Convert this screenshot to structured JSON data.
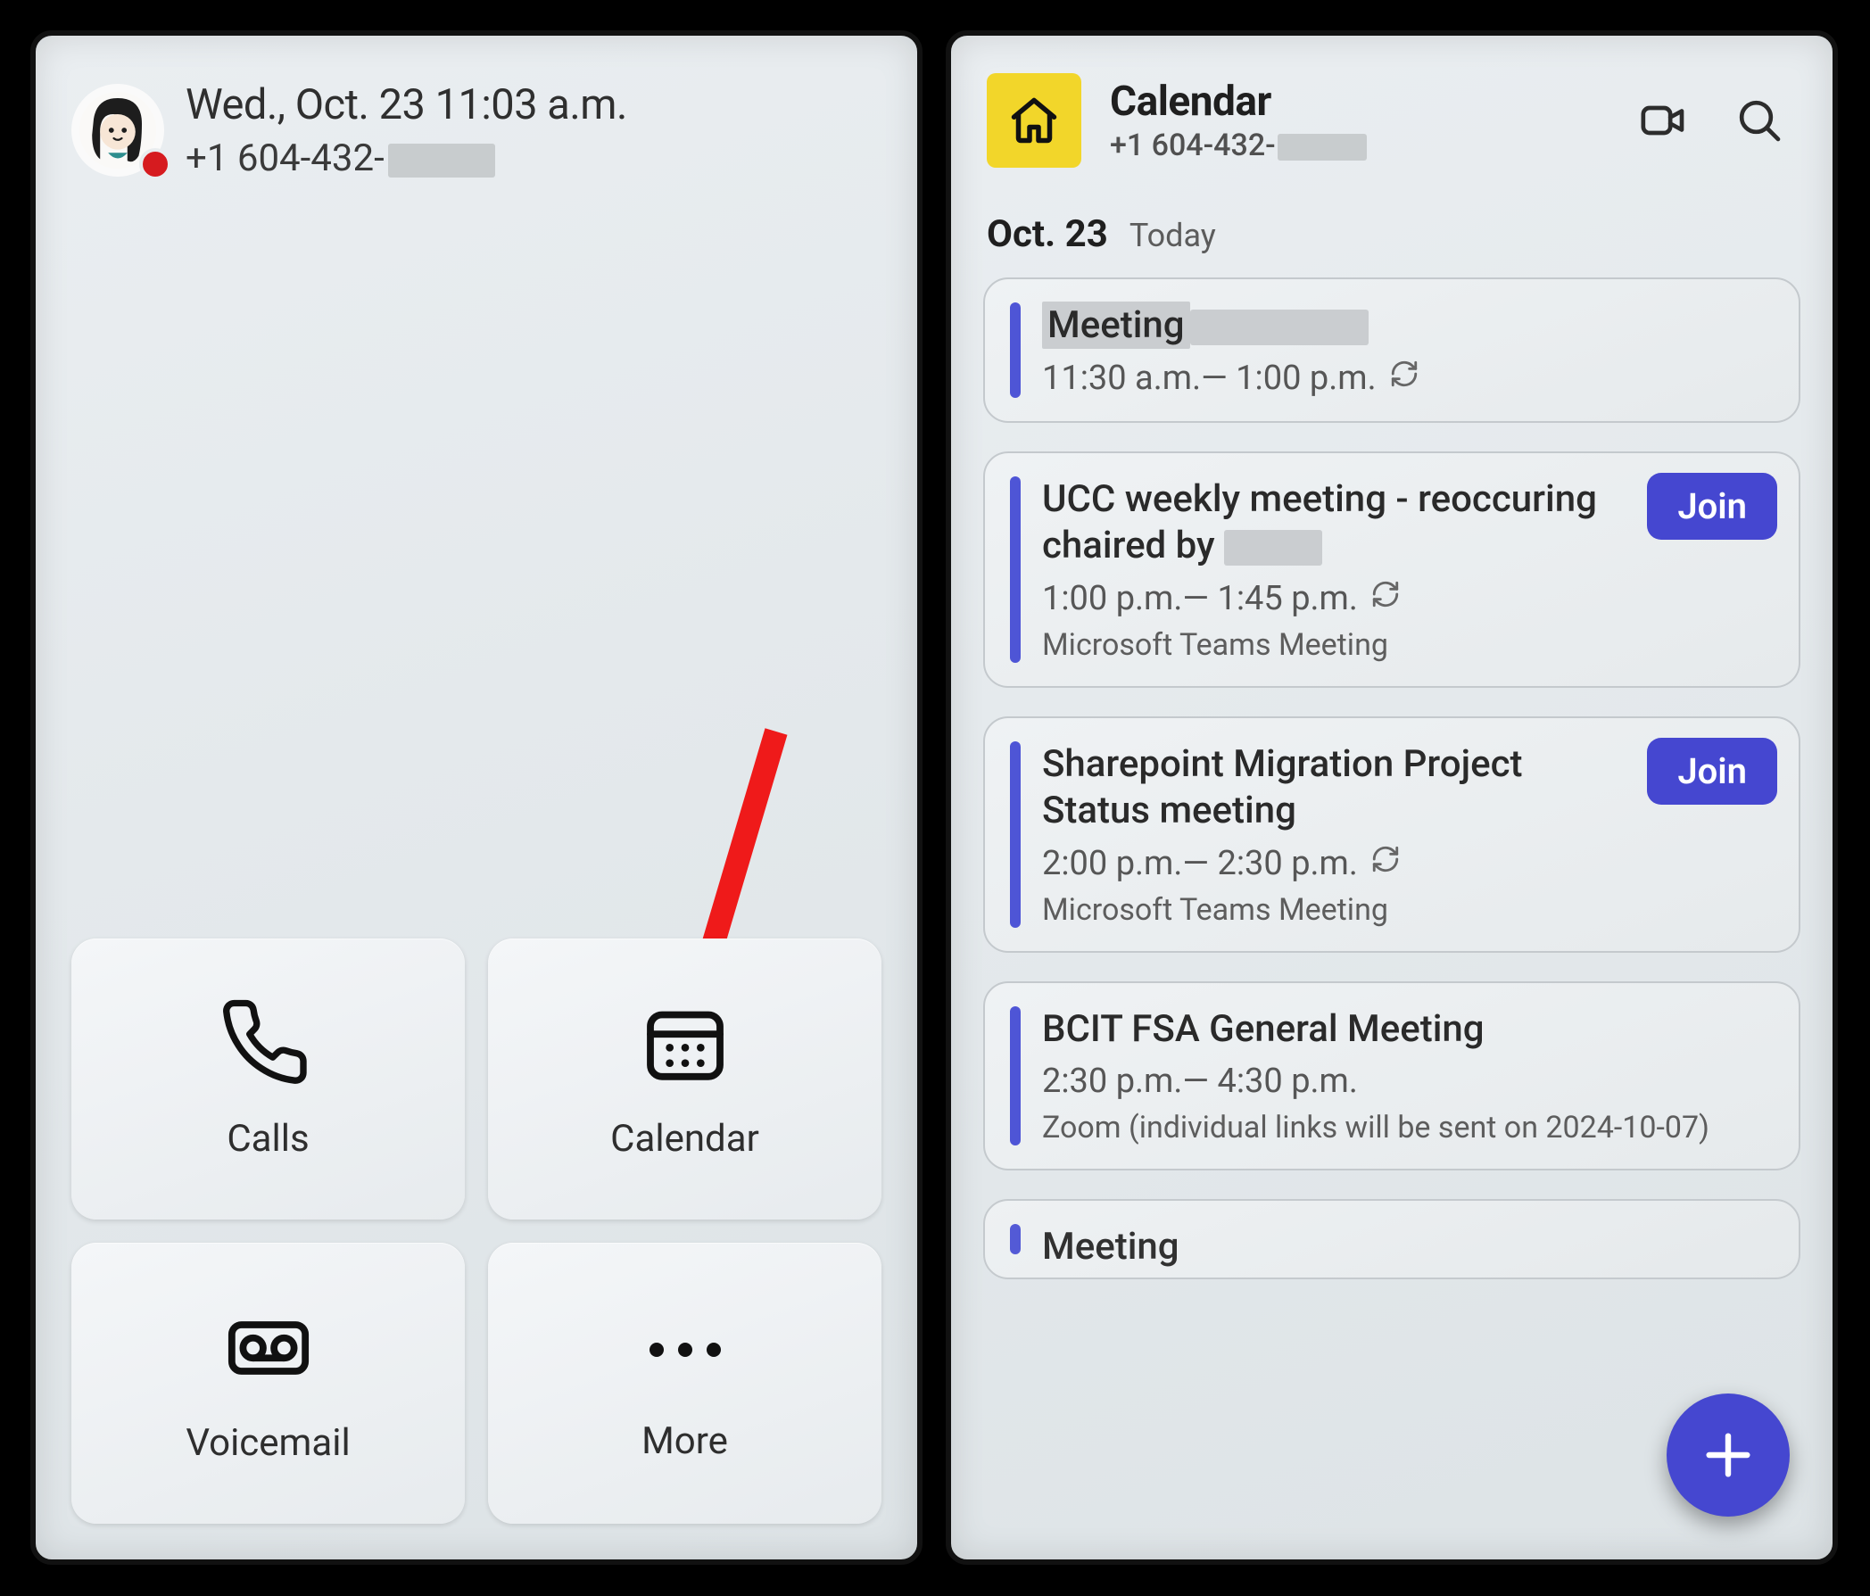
{
  "left": {
    "datetime": "Wed., Oct. 23 11:03 a.m.",
    "phone_prefix": "+1 604-432-",
    "tiles": {
      "calls": {
        "label": "Calls"
      },
      "calendar": {
        "label": "Calendar"
      },
      "voicemail": {
        "label": "Voicemail"
      },
      "more": {
        "label": "More"
      }
    }
  },
  "right": {
    "title": "Calendar",
    "phone_prefix": "+1 604-432-",
    "date_label": "Oct. 23",
    "date_rel": "Today",
    "join_label": "Join",
    "events": [
      {
        "title": "Meeting",
        "time": "11:30 a.m.— 1:00 p.m.",
        "recurring": true,
        "title_masked": true
      },
      {
        "title": "UCC weekly meeting - reoccuring chaired by",
        "time": "1:00 p.m.— 1:45 p.m.",
        "location": "Microsoft Teams Meeting",
        "recurring": true,
        "join": true,
        "trail_mask": true
      },
      {
        "title": "Sharepoint Migration Project Status meeting",
        "time": "2:00 p.m.— 2:30 p.m.",
        "location": "Microsoft Teams Meeting",
        "recurring": true,
        "join": true
      },
      {
        "title": "BCIT FSA General Meeting",
        "time": "2:30 p.m.— 4:30 p.m.",
        "location": "Zoom (individual links will be sent on 2024-10-07)"
      },
      {
        "title": "Meeting",
        "partial": true
      }
    ]
  }
}
